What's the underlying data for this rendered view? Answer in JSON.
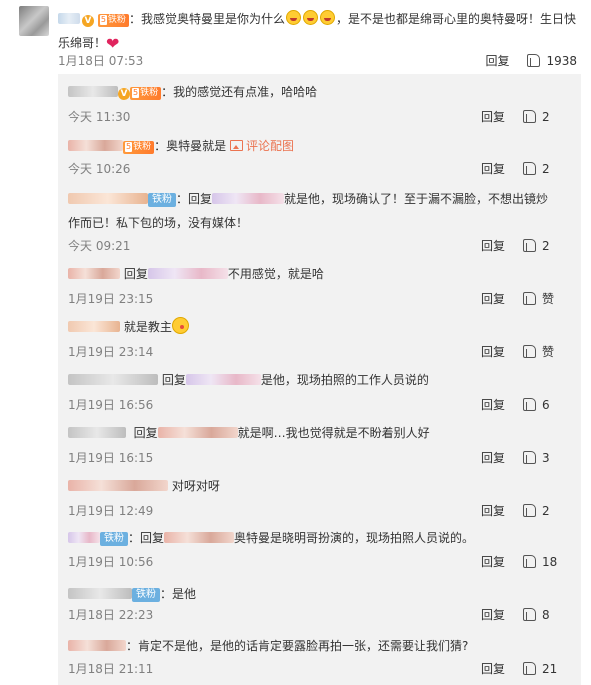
{
  "main": {
    "text_before": "：我感觉奥特曼里是你为什么",
    "text_after": "，是不是也都是绵哥心里的奥特曼呀！生日快乐绵哥！",
    "fan_level": "5",
    "fan_label": "铁粉",
    "time": "1月18日 07:53",
    "reply_label": "回复",
    "likes": "1938"
  },
  "replies": [
    {
      "fan_level": "5",
      "fan_label": "铁粉",
      "text": "：我的感觉还有点准，哈哈哈",
      "time": "今天 11:30",
      "reply_label": "回复",
      "likes": "2"
    },
    {
      "fan_level": "5",
      "fan_label": "铁粉",
      "text": "：奥特曼就是",
      "pic_label": "评论配图",
      "time": "今天 10:26",
      "reply_label": "回复",
      "likes": "2"
    },
    {
      "badge": "铁粉",
      "prefix": "：回复",
      "suffix": "就是他，现场确认了！至于漏不漏脸，不想出镜炒",
      "line2": "作而已！私下包的场，没有媒体！",
      "time": "今天 09:21",
      "reply_label": "回复",
      "likes": "2"
    },
    {
      "prefix": "回复",
      "suffix": "不用感觉，就是哈",
      "time": "1月19日 23:15",
      "reply_label": "回复",
      "likes": "赞"
    },
    {
      "text": "就是教主",
      "time": "1月19日 23:14",
      "reply_label": "回复",
      "likes": "赞"
    },
    {
      "prefix": "回复",
      "suffix": "是他，现场拍照的工作人员说的",
      "time": "1月19日 16:56",
      "reply_label": "回复",
      "likes": "6"
    },
    {
      "prefix": "回复",
      "suffix": "就是啊…我也觉得就是不盼着别人好",
      "time": "1月19日 16:15",
      "reply_label": "回复",
      "likes": "3"
    },
    {
      "text": "对呀对呀",
      "time": "1月19日 12:49",
      "reply_label": "回复",
      "likes": "2"
    },
    {
      "badge": "铁粉",
      "prefix": "：回复",
      "suffix": "奥特曼是晓明哥扮演的，现场拍照人员说的。",
      "time": "1月19日 10:56",
      "reply_label": "回复",
      "likes": "18"
    },
    {
      "badge": "铁粉",
      "text": "：是他",
      "time": "1月18日 22:23",
      "reply_label": "回复",
      "likes": "8"
    },
    {
      "text": "：肯定不是他，是他的话肯定要露脸再拍一张，还需要让我们猜?",
      "time": "1月18日 21:11",
      "reply_label": "回复",
      "likes": "21"
    }
  ]
}
